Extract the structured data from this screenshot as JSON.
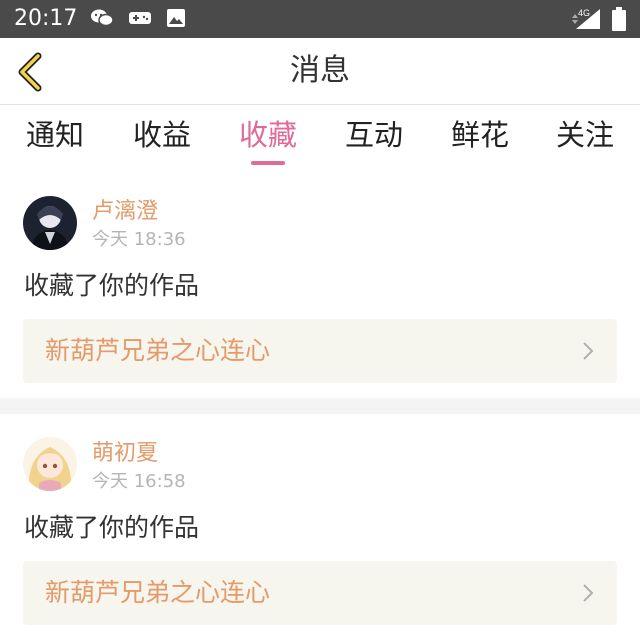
{
  "status_bar": {
    "time": "20:17",
    "network": "4G"
  },
  "header": {
    "title": "消息"
  },
  "tabs": [
    {
      "label": "通知"
    },
    {
      "label": "收益"
    },
    {
      "label": "收藏",
      "active": true
    },
    {
      "label": "互动"
    },
    {
      "label": "鲜花"
    },
    {
      "label": "关注"
    }
  ],
  "messages": [
    {
      "user": "卢漓澄",
      "time": "今天 18:36",
      "action": "收藏了你的作品",
      "work": "新葫芦兄弟之心连心"
    },
    {
      "user": "萌初夏",
      "time": "今天 16:58",
      "action": "收藏了你的作品",
      "work": "新葫芦兄弟之心连心"
    }
  ],
  "colors": {
    "accent": "#e06a9a",
    "username": "#e49a6a",
    "status_bar": "#4a4a4a",
    "card_bg": "#f6f5ee"
  }
}
